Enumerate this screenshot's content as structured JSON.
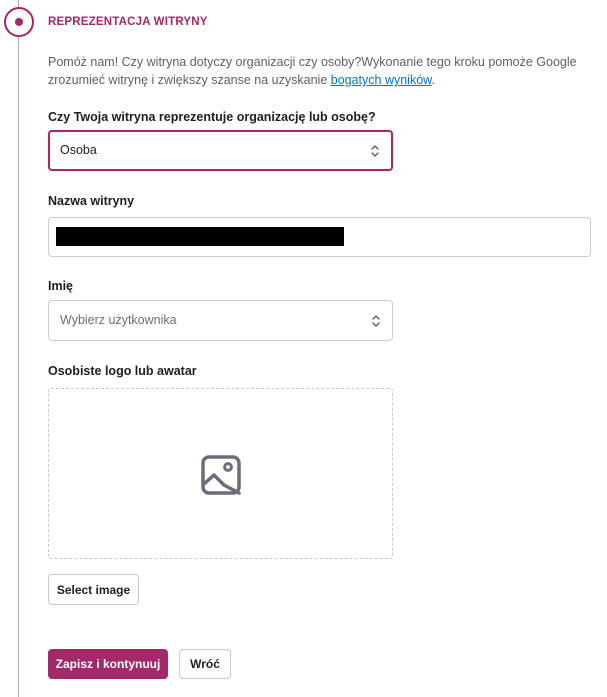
{
  "step": {
    "title": "REPREZENTACJA WITRYNY",
    "intro_text": "Pomóż nam! Czy witryna dotyczy organizacji czy osoby?Wykonanie tego kroku pomoże Google zrozumieć witrynę i zwiększy szanse na uzyskanie ",
    "intro_link": "bogatych wyników",
    "intro_end": "."
  },
  "representation": {
    "label": "Czy Twoja witryna reprezentuje organizację lub osobę?",
    "value": "Osoba"
  },
  "site_name": {
    "label": "Nazwa witryny"
  },
  "name_field": {
    "label": "Imię",
    "placeholder": "Wybierz użytkownika"
  },
  "logo": {
    "label": "Osobiste logo lub awatar",
    "select_button": "Select image"
  },
  "actions": {
    "save": "Zapisz i kontynuuj",
    "back": "Wróć"
  },
  "colors": {
    "accent": "#a4286a",
    "link": "#0675c4"
  },
  "icons": {
    "step": "step-active-dot-icon",
    "select": "chevron-up-down-icon",
    "image": "image-placeholder-icon"
  }
}
